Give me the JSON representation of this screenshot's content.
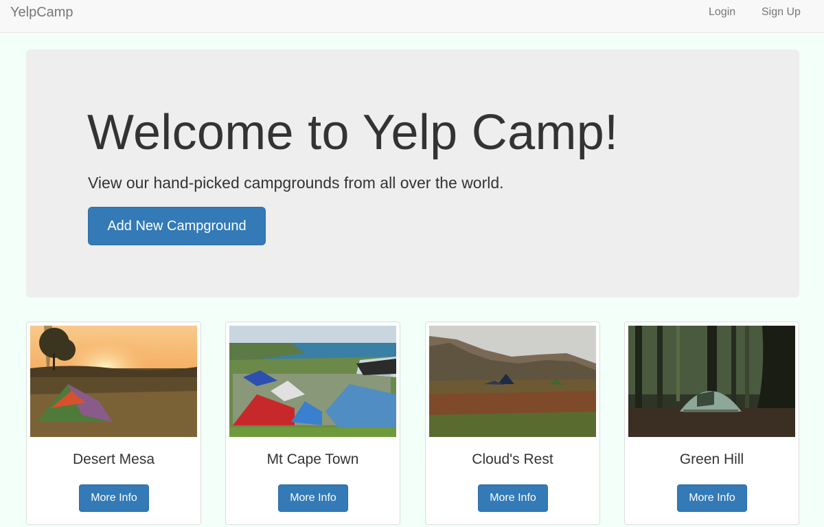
{
  "navbar": {
    "brand": "YelpCamp",
    "login": "Login",
    "signup": "Sign Up"
  },
  "jumbotron": {
    "title": "Welcome to Yelp Camp!",
    "subtitle": "View our hand-picked campgrounds from all over the world.",
    "button": "Add New Campground"
  },
  "campgrounds": [
    {
      "name": "Desert Mesa",
      "button": "More Info",
      "image": "sunset-tent-photo"
    },
    {
      "name": "Mt Cape Town",
      "button": "More Info",
      "image": "crowded-tents-coast-photo"
    },
    {
      "name": "Cloud's Rest",
      "button": "More Info",
      "image": "mountain-valley-camp-photo"
    },
    {
      "name": "Green Hill",
      "button": "More Info",
      "image": "forest-tent-photo"
    }
  ],
  "colors": {
    "primary": "#337ab7",
    "background": "#f3fff9",
    "jumbotron": "#eeeeee"
  }
}
